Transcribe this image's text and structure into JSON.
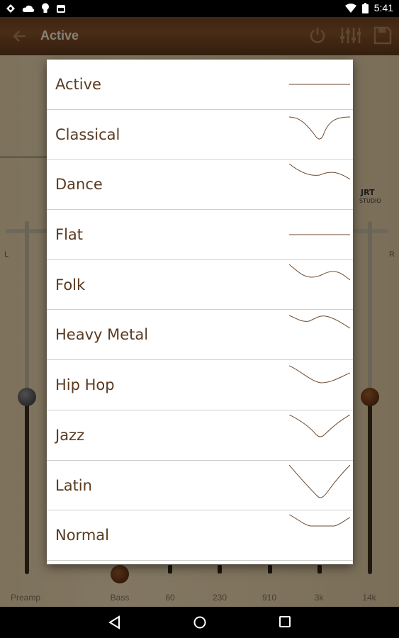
{
  "status_bar": {
    "time": "5:41"
  },
  "toolbar": {
    "title": "Active"
  },
  "panel": {
    "left_channel": "L",
    "right_channel": "R",
    "freq_labels": [
      "Preamp",
      "Bass",
      "60",
      "230",
      "910",
      "3k",
      "14k"
    ]
  },
  "presets": [
    {
      "label": "Active"
    },
    {
      "label": "Classical"
    },
    {
      "label": "Dance"
    },
    {
      "label": "Flat"
    },
    {
      "label": "Folk"
    },
    {
      "label": "Heavy Metal"
    },
    {
      "label": "Hip Hop"
    },
    {
      "label": "Jazz"
    },
    {
      "label": "Latin"
    },
    {
      "label": "Normal"
    }
  ],
  "colors": {
    "accent_text": "#5a3a20",
    "curve": "#6b4a30",
    "toolbar_wood": "#7d4d27"
  },
  "icons": [
    "back-arrow-icon",
    "power-icon",
    "equalizer-icon",
    "save-icon"
  ]
}
